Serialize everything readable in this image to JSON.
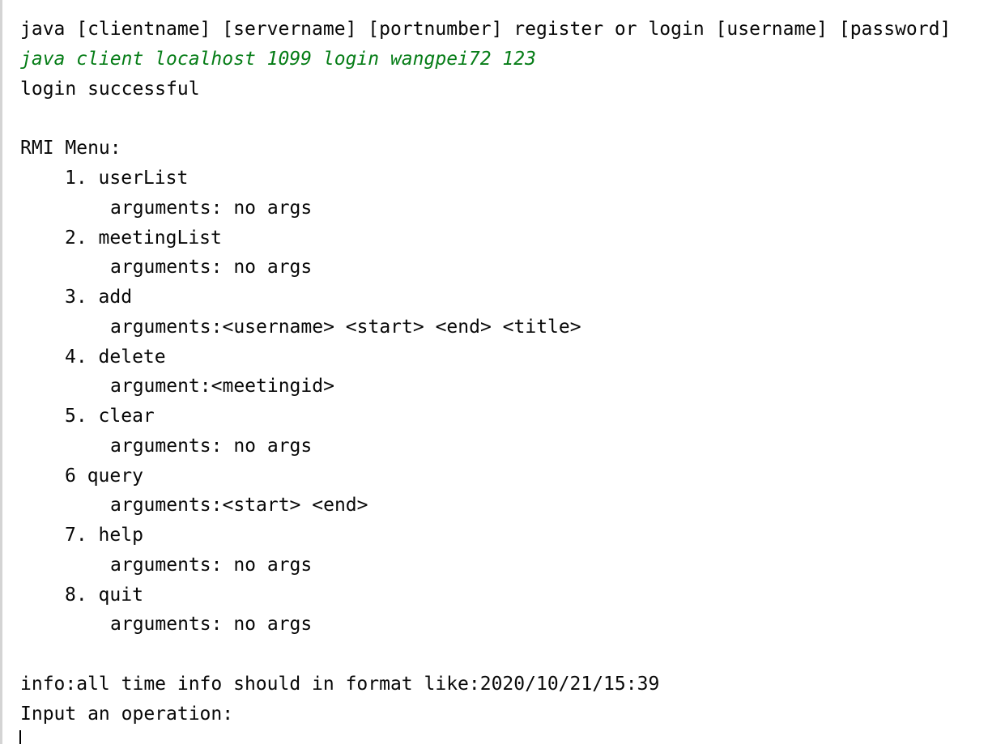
{
  "console": {
    "usage": "java [clientname] [servername] [portnumber] register or login [username] [password]",
    "command_input": "java client localhost 1099 login wangpei72 123",
    "login_result": "login successful",
    "menu_title": "RMI Menu:",
    "menu_items": [
      {
        "name": "1. userList",
        "args": "arguments: no args"
      },
      {
        "name": "2. meetingList",
        "args": "arguments: no args"
      },
      {
        "name": "3. add",
        "args": "arguments:<username> <start> <end> <title>"
      },
      {
        "name": "4. delete",
        "args": "argument:<meetingid>"
      },
      {
        "name": "5. clear",
        "args": "arguments: no args"
      },
      {
        "name": "6 query",
        "args": "arguments:<start> <end>"
      },
      {
        "name": "7. help",
        "args": "arguments: no args"
      },
      {
        "name": "8. quit",
        "args": "arguments: no args"
      }
    ],
    "info": "info:all time info should in format like:2020/10/21/15:39",
    "prompt": "Input an operation:",
    "colors": {
      "text": "#080808",
      "input_echo": "#067d17",
      "border": "#d4d4d4"
    }
  }
}
